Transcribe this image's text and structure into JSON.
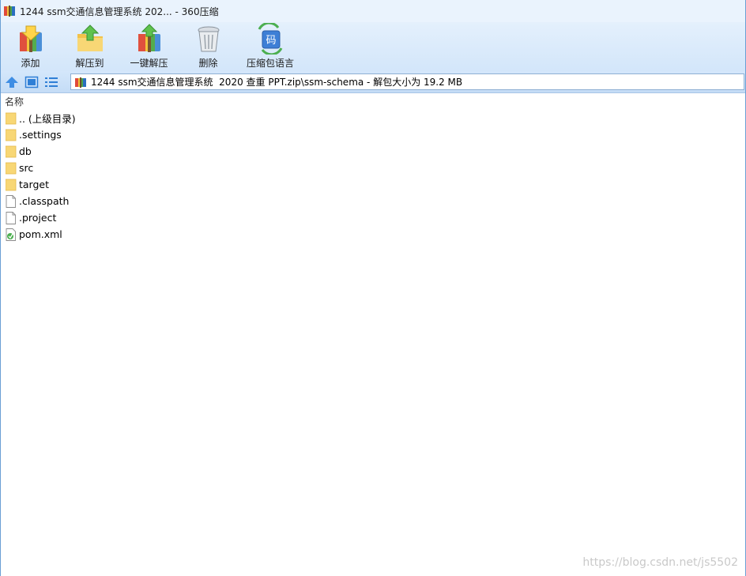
{
  "titlebar": {
    "title": "1244 ssm交通信息管理系统  202... - 360压缩"
  },
  "toolbar": {
    "buttons": [
      {
        "label": "添加",
        "icon": "add-archive-icon"
      },
      {
        "label": "解压到",
        "icon": "extract-to-icon"
      },
      {
        "label": "一键解压",
        "icon": "one-click-extract-icon"
      },
      {
        "label": "删除",
        "icon": "trash-icon"
      },
      {
        "label": "压缩包语言",
        "icon": "archive-encoding-icon"
      }
    ]
  },
  "addressbar": {
    "path": "1244 ssm交通信息管理系统  2020 查重 PPT.zip\\ssm-schema - 解包大小为 19.2 MB"
  },
  "list": {
    "column_name": "名称",
    "items": [
      {
        "name": ".. (上级目录)",
        "type": "folder"
      },
      {
        "name": ".settings",
        "type": "folder"
      },
      {
        "name": "db",
        "type": "folder"
      },
      {
        "name": "src",
        "type": "folder"
      },
      {
        "name": "target",
        "type": "folder"
      },
      {
        "name": ".classpath",
        "type": "file"
      },
      {
        "name": ".project",
        "type": "file"
      },
      {
        "name": "pom.xml",
        "type": "xml"
      }
    ]
  },
  "watermark": "https://blog.csdn.net/js5502",
  "colors": {
    "toolbar_bg": "#d3e6fa",
    "accent": "#2f7fd6",
    "folder": "#f8d775"
  }
}
